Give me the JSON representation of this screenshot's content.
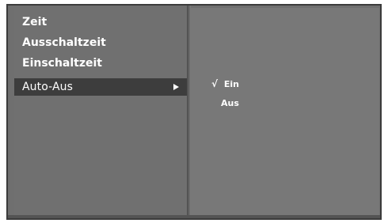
{
  "menu": {
    "items": [
      {
        "label": "Zeit"
      },
      {
        "label": "Ausschaltzeit"
      },
      {
        "label": "Einschaltzeit"
      },
      {
        "label": "Auto-Aus"
      }
    ]
  },
  "submenu": {
    "options": [
      {
        "label": "Ein",
        "checked": "√"
      },
      {
        "label": "Aus",
        "checked": ""
      }
    ]
  },
  "colors": {
    "panel": "#707070",
    "selected": "#3d3d3d",
    "text": "#ffffff"
  }
}
